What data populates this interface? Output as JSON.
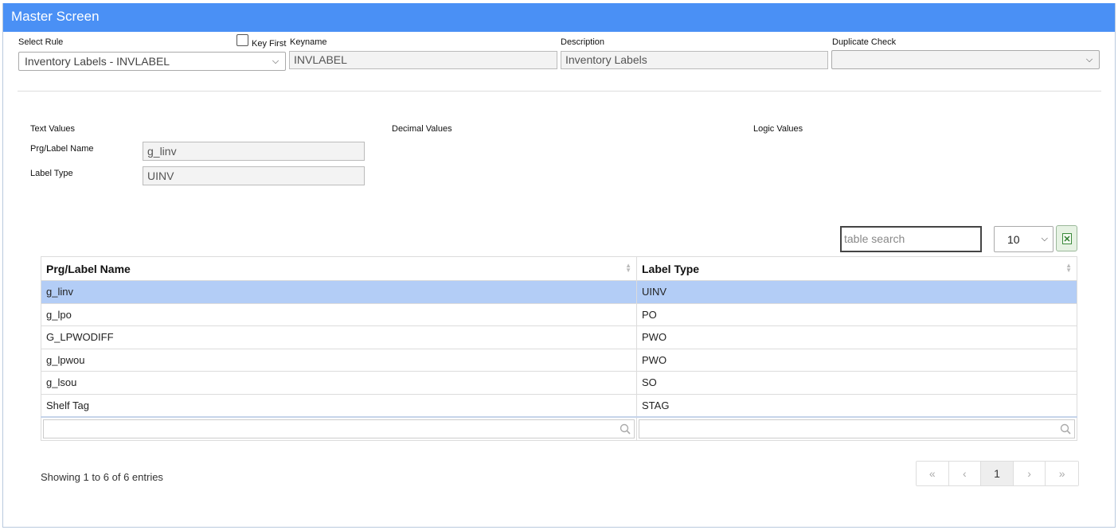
{
  "title": "Master Screen",
  "rule": {
    "label": "Select Rule",
    "value": "Inventory Labels - INVLABEL",
    "key_first_label": "Key First",
    "key_first_checked": false
  },
  "keyname": {
    "label": "Keyname",
    "value": "INVLABEL"
  },
  "description": {
    "label": "Description",
    "value": "Inventory Labels"
  },
  "duplicate_check": {
    "label": "Duplicate Check",
    "value": ""
  },
  "sections": {
    "text_values": "Text Values",
    "decimal_values": "Decimal Values",
    "logic_values": "Logic Values"
  },
  "fields": {
    "prg_label_name": {
      "label": "Prg/Label Name",
      "value": "g_linv"
    },
    "label_type": {
      "label": "Label Type",
      "value": "UINV"
    }
  },
  "table": {
    "search_placeholder": "table search",
    "page_size": "10",
    "columns": [
      "Prg/Label Name",
      "Label Type"
    ],
    "rows": [
      {
        "name": "g_linv",
        "type": "UINV",
        "selected": true
      },
      {
        "name": "g_lpo",
        "type": "PO"
      },
      {
        "name": "G_LPWODIFF",
        "type": "PWO"
      },
      {
        "name": "g_lpwou",
        "type": "PWO"
      },
      {
        "name": "g_lsou",
        "type": "SO"
      },
      {
        "name": "Shelf Tag",
        "type": "STAG"
      }
    ],
    "info": "Showing 1 to 6 of 6 entries",
    "pagination": {
      "first": "«",
      "prev": "‹",
      "current": "1",
      "next": "›",
      "last": "»"
    }
  },
  "colors": {
    "titlebar": "#4a90f5",
    "selected_row": "#b3cdf6"
  },
  "icons": [
    "chevron-down-icon",
    "sort-icon",
    "excel-icon",
    "search-icon"
  ]
}
